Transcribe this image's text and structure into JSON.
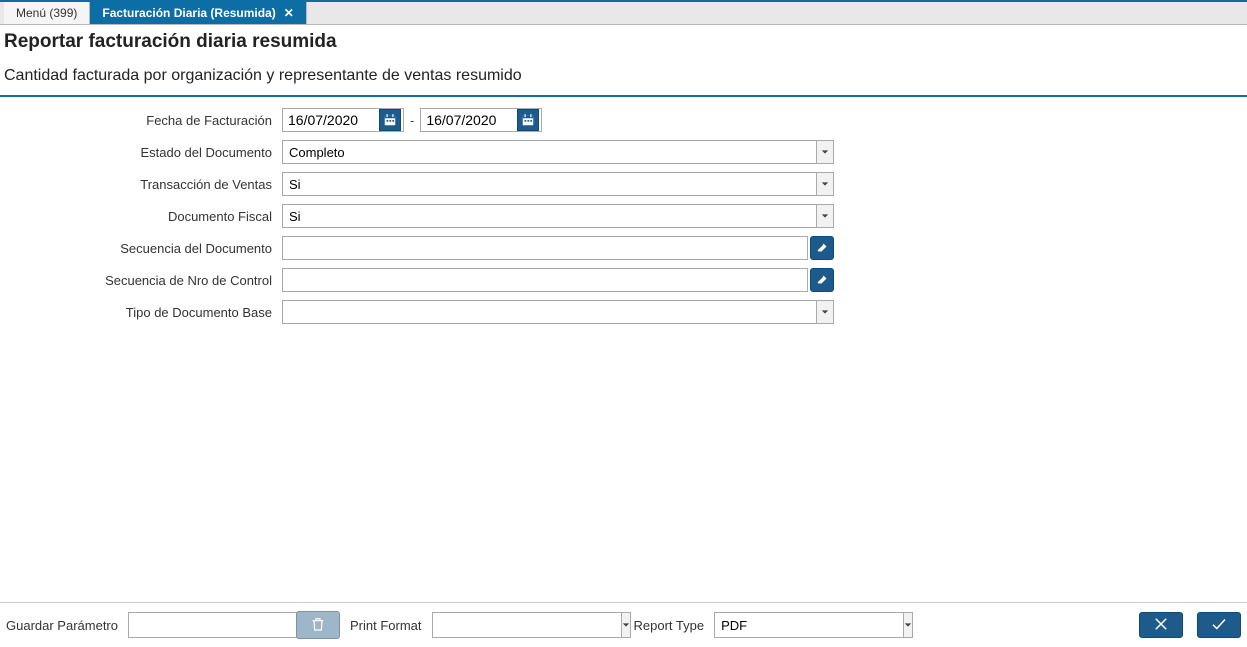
{
  "tabs": {
    "menu": "Menú (399)",
    "active": "Facturación Diaria (Resumida)"
  },
  "header": {
    "title": "Reportar facturación diaria resumida",
    "subtitle": "Cantidad facturada por organización y representante de ventas resumido"
  },
  "form": {
    "fecha_facturacion": {
      "label": "Fecha de Facturación",
      "from": "16/07/2020",
      "to": "16/07/2020",
      "sep": "-"
    },
    "estado_documento": {
      "label": "Estado del Documento",
      "value": "Completo"
    },
    "transaccion_ventas": {
      "label": "Transacción de Ventas",
      "value": "Si"
    },
    "documento_fiscal": {
      "label": "Documento Fiscal",
      "value": "Si"
    },
    "secuencia_documento": {
      "label": "Secuencia del Documento",
      "value": ""
    },
    "secuencia_nro_control": {
      "label": "Secuencia de Nro de Control",
      "value": ""
    },
    "tipo_documento_base": {
      "label": "Tipo de Documento Base",
      "value": ""
    }
  },
  "footer": {
    "guardar_parametro": {
      "label": "Guardar Parámetro",
      "value": ""
    },
    "print_format": {
      "label": "Print Format",
      "value": ""
    },
    "report_type": {
      "label": "Report Type",
      "value": "PDF"
    }
  }
}
